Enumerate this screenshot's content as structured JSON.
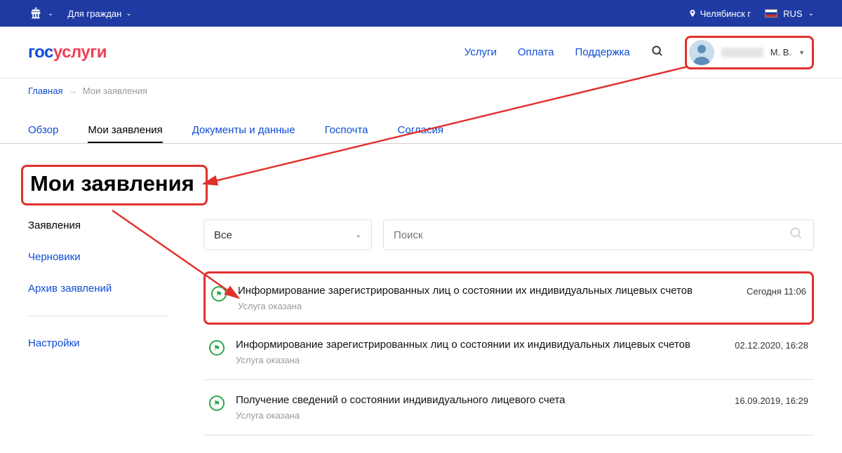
{
  "topbar": {
    "citizens": "Для граждан",
    "city": "Челябинск г",
    "lang": "RUS"
  },
  "logo": {
    "part1": "гос",
    "part2": "услуги"
  },
  "nav": {
    "services": "Услуги",
    "payment": "Оплата",
    "support": "Поддержка"
  },
  "user": {
    "initials": "М. В."
  },
  "breadcrumb": {
    "home": "Главная",
    "current": "Мои заявления"
  },
  "tabs": {
    "overview": "Обзор",
    "apps": "Мои заявления",
    "docs": "Документы и данные",
    "mail": "Госпочта",
    "consent": "Согласия"
  },
  "page_title": "Мои заявления",
  "sidebar": {
    "apps": "Заявления",
    "drafts": "Черновики",
    "archive": "Архив заявлений",
    "settings": "Настройки"
  },
  "filter": {
    "all": "Все",
    "search_ph": "Поиск"
  },
  "list": [
    {
      "title": "Информирование зарегистрированных лиц о состоянии их индивидуальных лицевых счетов",
      "status": "Услуга оказана",
      "date": "Сегодня 11:06"
    },
    {
      "title": "Информирование зарегистрированных лиц о состоянии их индивидуальных лицевых счетов",
      "status": "Услуга оказана",
      "date": "02.12.2020, 16:28"
    },
    {
      "title": "Получение сведений о состоянии индивидуального лицевого счета",
      "status": "Услуга оказана",
      "date": "16.09.2019, 16:29"
    }
  ]
}
